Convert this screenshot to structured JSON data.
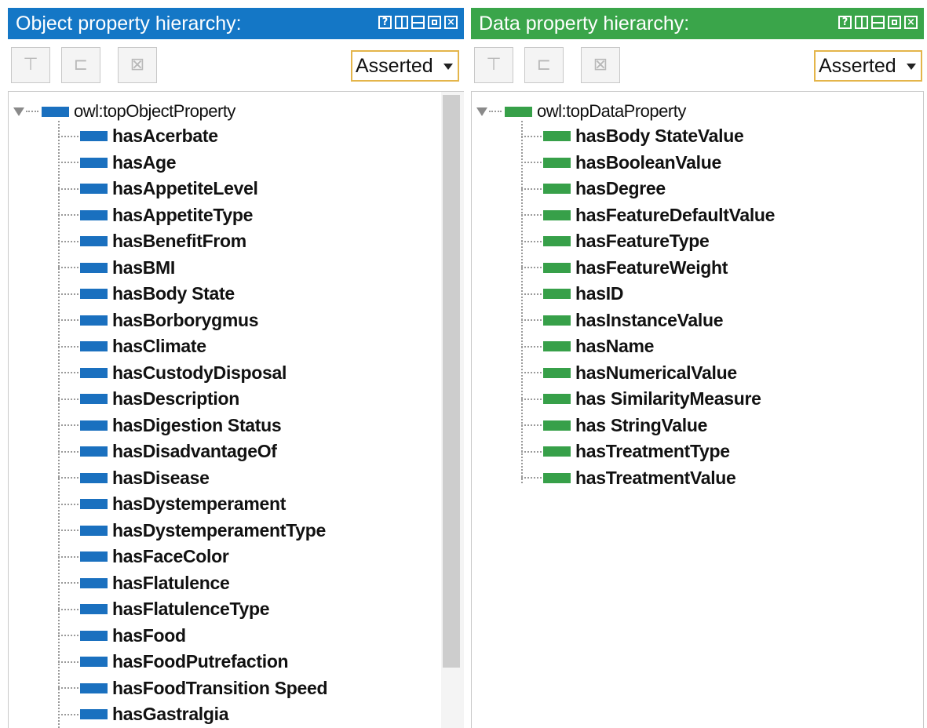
{
  "colors": {
    "object_accent": "#1477c6",
    "data_accent": "#3aa54a"
  },
  "object_panel": {
    "title": "Object property hierarchy:",
    "window_buttons": [
      "help-icon",
      "split-icon",
      "minimize-icon",
      "maximize-icon",
      "close-icon"
    ],
    "toolbar": {
      "icons": [
        "add-subproperty-icon",
        "add-sibling-property-icon",
        "delete-property-icon"
      ]
    },
    "view_select": "Asserted",
    "root": "owl:topObjectProperty",
    "items": [
      {
        "label": "hasAcerbate"
      },
      {
        "label": "hasAge"
      },
      {
        "label": "hasAppetiteLevel"
      },
      {
        "label": "hasAppetiteType"
      },
      {
        "label": "hasBenefitFrom"
      },
      {
        "label": "hasBMI"
      },
      {
        "label": "hasBody State"
      },
      {
        "label": "hasBorborygmus"
      },
      {
        "label": "hasClimate"
      },
      {
        "label": "hasCustodyDisposal"
      },
      {
        "label": "hasDescription"
      },
      {
        "label": "hasDigestion Status"
      },
      {
        "label": "hasDisadvantageOf"
      },
      {
        "label": "hasDisease"
      },
      {
        "label": "hasDystemperament"
      },
      {
        "label": "hasDystemperamentType"
      },
      {
        "label": "hasFaceColor"
      },
      {
        "label": "hasFlatulence"
      },
      {
        "label": "hasFlatulenceType"
      },
      {
        "label": "hasFood"
      },
      {
        "label": "hasFoodPutrefaction"
      },
      {
        "label": "hasFoodTransition Speed"
      },
      {
        "label": "hasGastralgia"
      }
    ]
  },
  "data_panel": {
    "title": "Data property hierarchy:",
    "window_buttons": [
      "help-icon",
      "split-icon",
      "minimize-icon",
      "maximize-icon",
      "close-icon"
    ],
    "toolbar": {
      "icons": [
        "add-subproperty-icon",
        "add-sibling-property-icon",
        "delete-property-icon"
      ]
    },
    "view_select": "Asserted",
    "root": "owl:topDataProperty",
    "items": [
      {
        "label": "hasBody StateValue"
      },
      {
        "label": "hasBooleanValue"
      },
      {
        "label": "hasDegree"
      },
      {
        "label": "hasFeatureDefaultValue"
      },
      {
        "label": "hasFeatureType"
      },
      {
        "label": "hasFeatureWeight"
      },
      {
        "label": "hasID"
      },
      {
        "label": "hasInstanceValue"
      },
      {
        "label": "hasName"
      },
      {
        "label": "hasNumericalValue"
      },
      {
        "label": "has SimilarityMeasure"
      },
      {
        "label": "has StringValue"
      },
      {
        "label": "hasTreatmentType"
      },
      {
        "label": "hasTreatmentValue"
      }
    ]
  }
}
